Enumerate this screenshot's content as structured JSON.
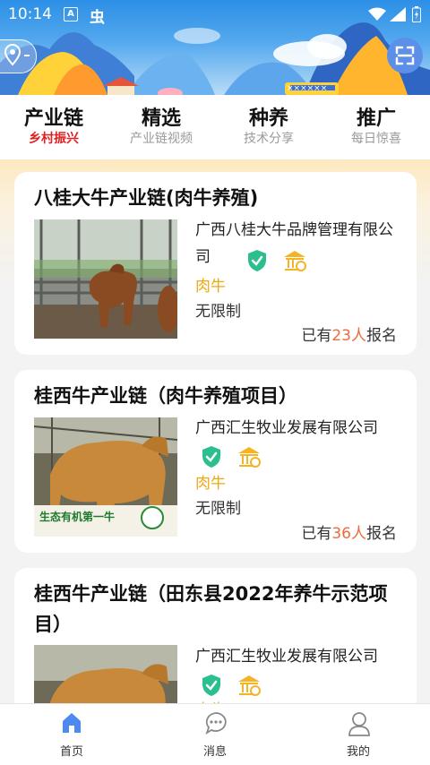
{
  "status_bar": {
    "time": "10:14",
    "input_indicator": "A",
    "app_glyph": "虫"
  },
  "banner": {
    "sign_text": "××××××"
  },
  "tabs": [
    {
      "title": "产业链",
      "subtitle": "乡村振兴",
      "active": true
    },
    {
      "title": "精选",
      "subtitle": "产业链视频",
      "active": false
    },
    {
      "title": "种养",
      "subtitle": "技术分享",
      "active": false
    },
    {
      "title": "推广",
      "subtitle": "每日惊喜",
      "active": false
    }
  ],
  "cards": [
    {
      "title": "八桂大牛产业链(肉牛养殖)",
      "company": "广西八桂大牛品牌管理有限公司",
      "tag": "肉牛",
      "limit": "无限制",
      "enroll_prefix": "已有",
      "enroll_count": "23人",
      "enroll_suffix": "报名"
    },
    {
      "title": "桂西牛产业链（肉牛养殖项目）",
      "company": "广西汇生牧业发展有限公司",
      "tag": "肉牛",
      "limit": "无限制",
      "enroll_prefix": "已有",
      "enroll_count": "36人",
      "enroll_suffix": "报名",
      "image_caption": "生态有机第一牛"
    },
    {
      "title": "桂西牛产业链（田东县2022年养牛示范项目）",
      "company": "广西汇生牧业发展有限公司",
      "tag": "肉牛"
    }
  ],
  "bottom_nav": [
    {
      "label": "首页",
      "icon": "home-icon",
      "active": true
    },
    {
      "label": "消息",
      "icon": "message-icon",
      "active": false
    },
    {
      "label": "我的",
      "icon": "profile-icon",
      "active": false
    }
  ],
  "colors": {
    "active_tab_subtitle": "#e02020",
    "tag": "#f0a810",
    "enroll_count": "#f06a3a",
    "verified_badge": "#2bbf8f",
    "gov_badge": "#f5b426",
    "nav_active": "#4d8af0"
  }
}
